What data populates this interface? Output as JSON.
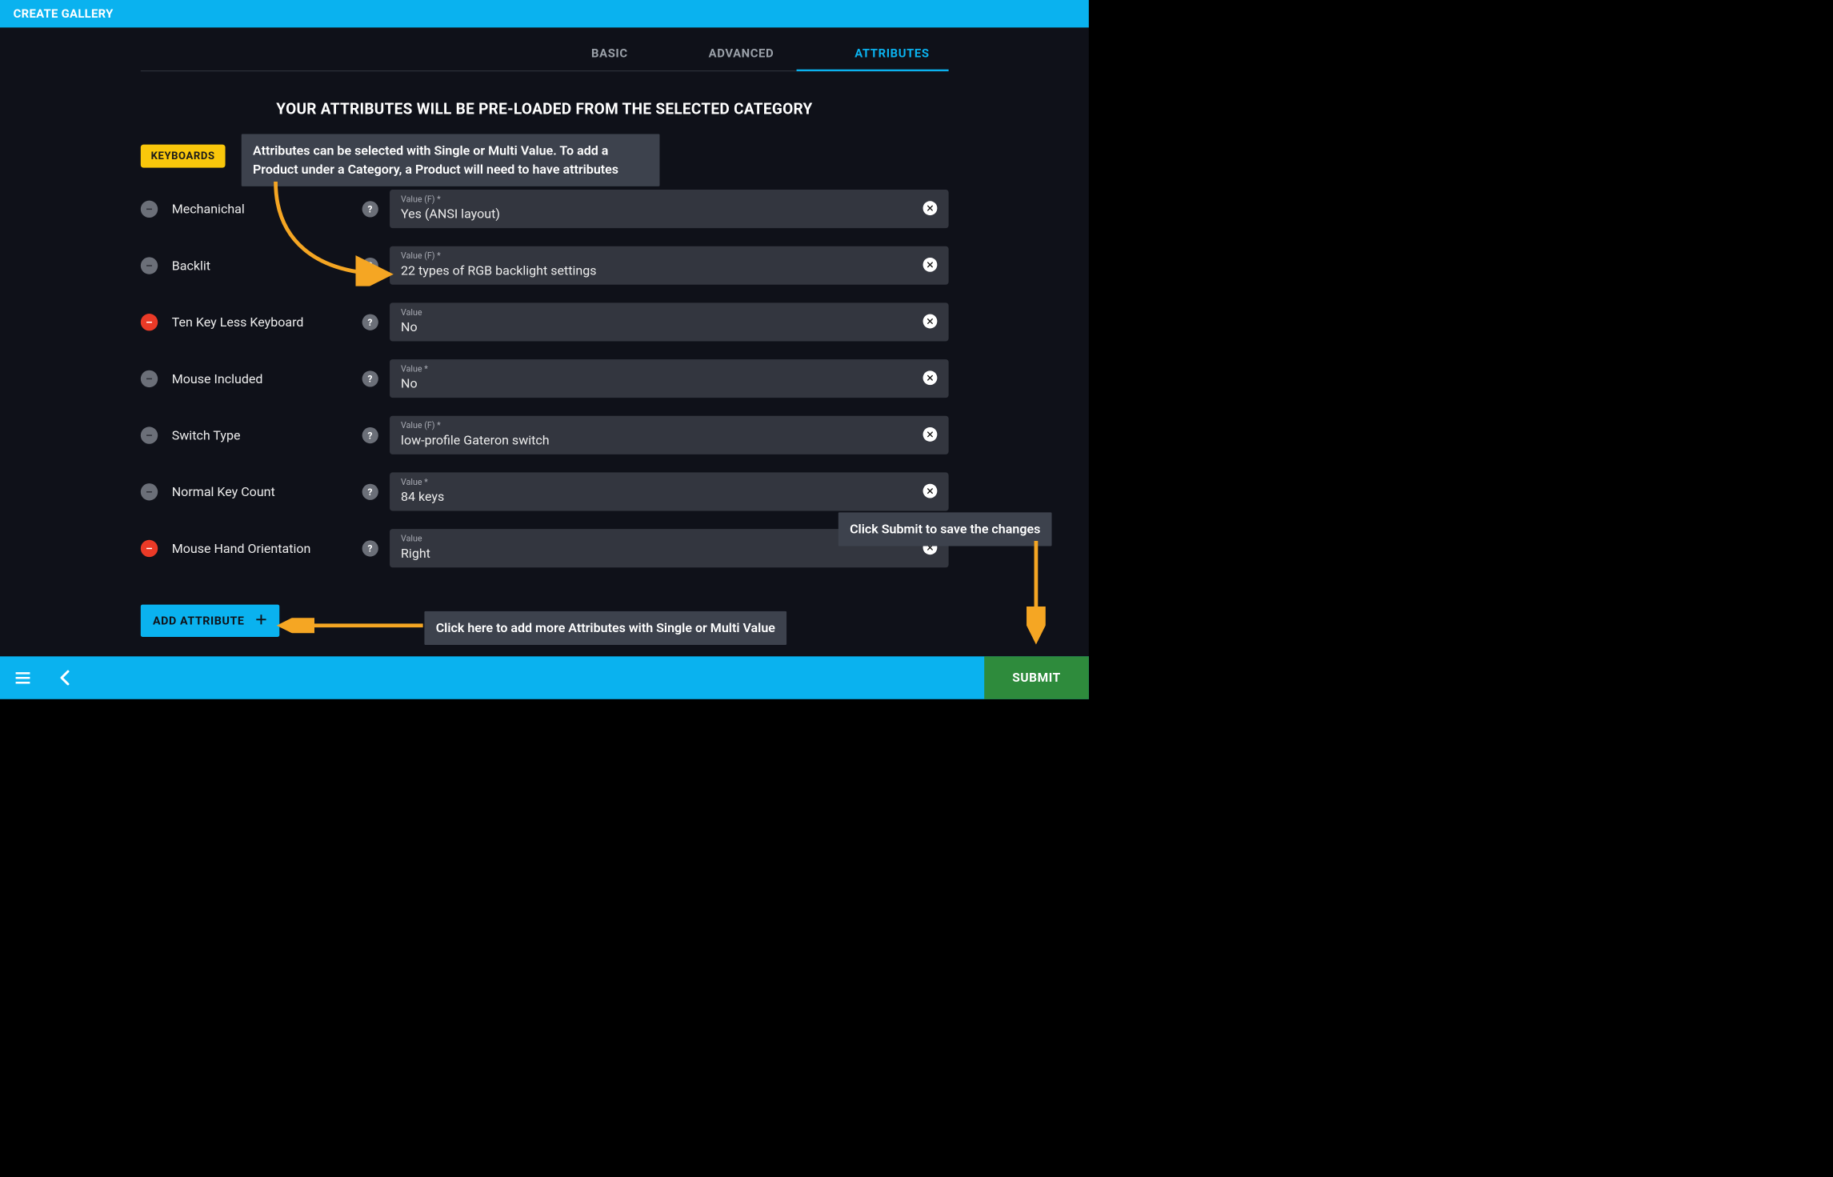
{
  "header": {
    "title": "CREATE GALLERY"
  },
  "tabs": {
    "basic": "BASIC",
    "advanced": "ADVANCED",
    "attributes": "ATTRIBUTES",
    "active": "attributes"
  },
  "headline": "YOUR ATTRIBUTES WILL BE PRE-LOADED FROM THE SELECTED CATEGORY",
  "category_chip": "KEYBOARDS",
  "attributes": [
    {
      "name": "Mechanichal",
      "icon": "gray",
      "value_label": "Value (F) *",
      "value": "Yes (ANSI layout)"
    },
    {
      "name": "Backlit",
      "icon": "gray",
      "value_label": "Value (F) *",
      "value": "22 types of RGB backlight settings"
    },
    {
      "name": "Ten Key Less Keyboard",
      "icon": "red",
      "value_label": "Value",
      "value": "No"
    },
    {
      "name": "Mouse Included",
      "icon": "gray",
      "value_label": "Value *",
      "value": "No"
    },
    {
      "name": "Switch Type",
      "icon": "gray",
      "value_label": "Value (F) *",
      "value": "low-profile Gateron switch"
    },
    {
      "name": "Normal Key Count",
      "icon": "gray",
      "value_label": "Value *",
      "value": "84 keys"
    },
    {
      "name": "Mouse Hand Orientation",
      "icon": "red",
      "value_label": "Value",
      "value": "Right"
    }
  ],
  "buttons": {
    "add_attribute": "ADD ATTRIBUTE",
    "submit": "SUBMIT"
  },
  "annotations": {
    "top": "Attributes can be selected with Single or Multi Value. To add a Product under a Category, a Product will need to have attributes",
    "bottom": "Click here to add more Attributes with Single or Multi Value",
    "submit": "Click Submit to save the changes"
  }
}
